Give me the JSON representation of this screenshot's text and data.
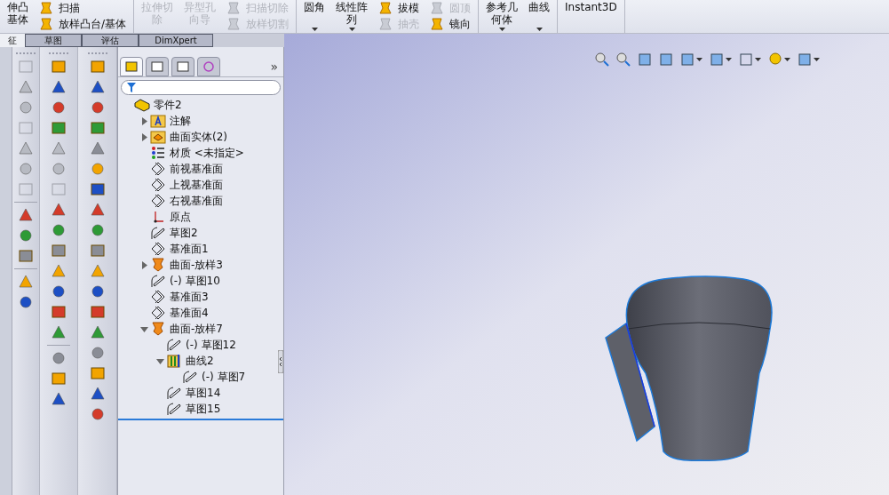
{
  "ribbon": {
    "groups": [
      {
        "columns": [
          {
            "kind": "large",
            "lines": [
              "伸凸",
              "基体"
            ],
            "disabled": false,
            "caret": false
          },
          {
            "kind": "stack",
            "items": [
              {
                "label": "扫描",
                "disabled": false
              },
              {
                "label": "放样凸台/基体",
                "disabled": false
              }
            ]
          }
        ]
      },
      {
        "columns": [
          {
            "kind": "large",
            "lines": [
              "拉伸切",
              "除"
            ],
            "disabled": true,
            "caret": false
          },
          {
            "kind": "large",
            "lines": [
              "异型孔",
              "向导"
            ],
            "disabled": true,
            "caret": false
          },
          {
            "kind": "stack",
            "items": [
              {
                "label": "扫描切除",
                "disabled": true
              },
              {
                "label": "放样切割",
                "disabled": true
              }
            ]
          }
        ]
      },
      {
        "columns": [
          {
            "kind": "large",
            "lines": [
              "圆角"
            ],
            "disabled": false,
            "caret": true
          },
          {
            "kind": "large",
            "lines": [
              "线性阵",
              "列"
            ],
            "disabled": false,
            "caret": true
          },
          {
            "kind": "stack",
            "items": [
              {
                "label": "拔模",
                "disabled": false
              },
              {
                "label": "抽壳",
                "disabled": true
              }
            ]
          },
          {
            "kind": "stack",
            "items": [
              {
                "label": "圆顶",
                "disabled": true
              },
              {
                "label": "镜向",
                "disabled": false
              }
            ]
          }
        ]
      },
      {
        "columns": [
          {
            "kind": "large",
            "lines": [
              "参考几",
              "何体"
            ],
            "disabled": false,
            "caret": true
          },
          {
            "kind": "large",
            "lines": [
              "曲线"
            ],
            "disabled": false,
            "caret": true
          }
        ]
      },
      {
        "columns": [
          {
            "kind": "large",
            "lines": [
              "Instant3D"
            ],
            "disabled": false,
            "caret": false
          }
        ]
      }
    ]
  },
  "command_tabs": [
    {
      "label": "征",
      "selected": true
    },
    {
      "label": "草图",
      "selected": false
    },
    {
      "label": "评估",
      "selected": false
    },
    {
      "label": "DimXpert",
      "selected": false
    }
  ],
  "manager": {
    "tabs": [
      {
        "selected": true
      },
      {
        "selected": false
      },
      {
        "selected": false
      },
      {
        "selected": false
      }
    ],
    "more": "»",
    "tree": {
      "label": "零件2",
      "kind": "part",
      "children": [
        {
          "label": "注解",
          "kind": "annotations",
          "expanded": false
        },
        {
          "label": "曲面实体(2)",
          "kind": "bodies",
          "expanded": false
        },
        {
          "label": "材质 <未指定>",
          "kind": "material"
        },
        {
          "label": "前视基准面",
          "kind": "plane"
        },
        {
          "label": "上视基准面",
          "kind": "plane"
        },
        {
          "label": "右视基准面",
          "kind": "plane"
        },
        {
          "label": "原点",
          "kind": "origin"
        },
        {
          "label": "草图2",
          "kind": "sketch"
        },
        {
          "label": "基准面1",
          "kind": "plane"
        },
        {
          "label": "曲面-放样3",
          "kind": "loft",
          "expanded": false
        },
        {
          "label": "(-) 草图10",
          "kind": "sketch"
        },
        {
          "label": "基准面3",
          "kind": "plane"
        },
        {
          "label": "基准面4",
          "kind": "plane"
        },
        {
          "label": "曲面-放样7",
          "kind": "loft",
          "expanded": true,
          "children": [
            {
              "label": "(-) 草图12",
              "kind": "sketch"
            },
            {
              "label": "曲线2",
              "kind": "curve",
              "expanded": true,
              "children": [
                {
                  "label": "(-) 草图7",
                  "kind": "sketch"
                }
              ]
            },
            {
              "label": "草图14",
              "kind": "sketch"
            },
            {
              "label": "草图15",
              "kind": "sketch"
            }
          ]
        }
      ]
    }
  }
}
